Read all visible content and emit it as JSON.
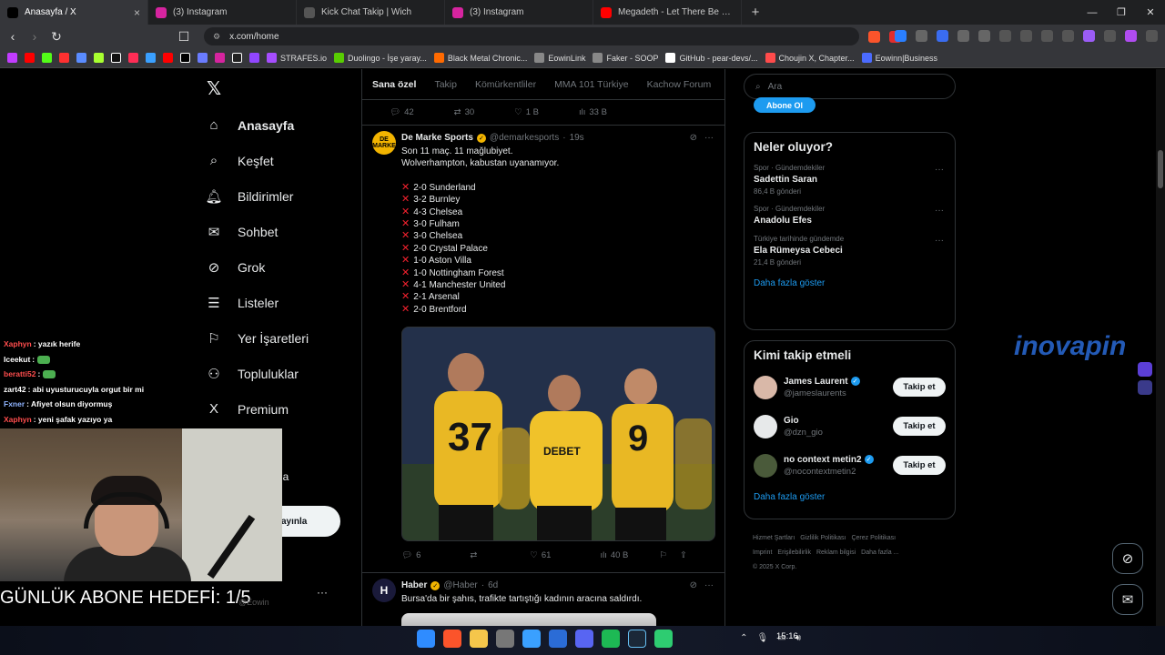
{
  "browser": {
    "tabs": [
      {
        "title": "Anasayfa / X",
        "favicon": "x-icon",
        "color": "#000000",
        "active": true
      },
      {
        "title": "(3) Instagram",
        "favicon": "instagram-icon",
        "color": "#d6249f",
        "active": false
      },
      {
        "title": "Kick Chat Takip | Wich",
        "favicon": "globe-icon",
        "color": "#555555",
        "active": false
      },
      {
        "title": "(3) Instagram",
        "favicon": "instagram-icon",
        "color": "#d6249f",
        "active": false
      },
      {
        "title": "Megadeth - Let There Be Shred (Offici",
        "favicon": "youtube-icon",
        "color": "#ff0000",
        "active": false
      }
    ],
    "url": "x.com/home",
    "bookmarks": [
      {
        "label": "STRAFES.io",
        "color": "#a64dff"
      },
      {
        "label": "Duolingo - İşe yaray...",
        "color": "#58cc02"
      },
      {
        "label": "Black Metal Chronic...",
        "color": "#ff6a00"
      },
      {
        "label": "EowinLink",
        "color": "#888888"
      },
      {
        "label": "Faker - SOOP",
        "color": "#888888"
      },
      {
        "label": "GitHub - pear-devs/...",
        "color": "#ffffff"
      },
      {
        "label": "Choujin X, Chapter...",
        "color": "#ff4b4b"
      },
      {
        "label": "Eowinn|Business",
        "color": "#4b6bff"
      }
    ]
  },
  "x_nav": {
    "items": [
      {
        "label": "Anasayfa",
        "icon": "home-icon",
        "glyph": "⌂",
        "active": true
      },
      {
        "label": "Keşfet",
        "icon": "search-icon",
        "glyph": "⌕",
        "active": false
      },
      {
        "label": "Bildirimler",
        "icon": "bell-icon",
        "glyph": "🔔︎",
        "active": false
      },
      {
        "label": "Sohbet",
        "icon": "mail-icon",
        "glyph": "✉",
        "active": false
      },
      {
        "label": "Grok",
        "icon": "grok-icon",
        "glyph": "⊘",
        "active": false
      },
      {
        "label": "Listeler",
        "icon": "list-icon",
        "glyph": "☰",
        "active": false
      },
      {
        "label": "Yer İşaretleri",
        "icon": "bookmark-icon",
        "glyph": "⚐",
        "active": false
      },
      {
        "label": "Topluluklar",
        "icon": "communities-icon",
        "glyph": "⚇",
        "active": false
      },
      {
        "label": "Premium",
        "icon": "x-icon",
        "glyph": "X",
        "active": false
      }
    ],
    "more_label": "zla",
    "post_button": "ayınla"
  },
  "feed": {
    "tabs": [
      "Sana özel",
      "Takip",
      "Kömürkentliler",
      "MMA 101 Türkiye",
      "Kachow Forum"
    ],
    "prev_stats": {
      "replies": "42",
      "reposts": "30",
      "likes": "1 B",
      "views": "33 B"
    },
    "tweet1": {
      "name": "De Marke Sports",
      "handle": "@demarkesports",
      "time": "19s",
      "avatar_text": "DE MARKE",
      "line1": "Son 11 maç. 11 mağlubiyet.",
      "line2": "Wolverhampton, kabustan uyanamıyor.",
      "results": [
        "2-0 Sunderland",
        "3-2 Burnley",
        "4-3 Chelsea",
        "3-0 Fulham",
        "3-0 Chelsea",
        "2-0 Crystal Palace",
        "1-0 Aston Villa",
        "1-0 Nottingham Forest",
        "4-1 Manchester United",
        "2-1 Arsenal",
        "2-0 Brentford"
      ],
      "replies": "6",
      "reposts": "",
      "likes": "61",
      "views": "40 B"
    },
    "tweet2": {
      "name": "Haber",
      "handle": "@Haber",
      "time": "6d",
      "avatar_text": "H",
      "text": "Bursa'da bir şahıs, trafikte tartıştığı kadının aracına saldırdı."
    }
  },
  "right": {
    "search_placeholder": "Ara",
    "subscribe_label": "Abone Ol",
    "trends_title": "Neler oluyor?",
    "trends": [
      {
        "meta": "Spor · Gündemdekiler",
        "name": "Sadettin Saran",
        "count": "86,4 B gönderi"
      },
      {
        "meta": "Spor · Gündemdekiler",
        "name": "Anadolu Efes",
        "count": ""
      },
      {
        "meta": "Türkiye tarihinde gündemde",
        "name": "Ela Rümeysa Cebeci",
        "count": "21,4 B gönderi"
      }
    ],
    "show_more": "Daha fazla göster",
    "who_title": "Kimi takip etmeli",
    "who": [
      {
        "name": "James Laurent",
        "handle": "@jameslaurents",
        "verified": true,
        "color": "#d9b8a8"
      },
      {
        "name": "Gio",
        "handle": "@dzn_gio",
        "verified": false,
        "color": "#e7e9ea"
      },
      {
        "name": "no context metin2",
        "handle": "@nocontextmetin2",
        "verified": true,
        "color": "#4a5a3a"
      }
    ],
    "follow_label": "Takip et",
    "footer": [
      "Hizmet Şartları",
      "Gizlilik Politikası",
      "Çerez Politikası",
      "Imprint",
      "Erişilebilirlik",
      "Reklam bilgisi",
      "Daha fazla ...",
      "© 2025 X Corp."
    ]
  },
  "stream": {
    "chat": [
      {
        "user": "Xaphyn",
        "color": "#ff4d4d",
        "msg": "yazık herife"
      },
      {
        "user": "Iceekut",
        "color": "#ffffff",
        "msg": ""
      },
      {
        "user": "beratti52",
        "color": "#ff4d4d",
        "msg": ""
      },
      {
        "user": "zart42",
        "color": "#ffffff",
        "msg": "abi uyusturucuyla orgut bir mi"
      },
      {
        "user": "Fxner",
        "color": "#8fb4ff",
        "msg": "Afiyet olsun diyormuş"
      },
      {
        "user": "Xaphyn",
        "color": "#ff4d4d",
        "msg": "yeni şafak yazıyo ya"
      }
    ],
    "goal_text": "GÜNLÜK ABONE HEDEFİ: 1/5",
    "overlay_handle": "@Eowin",
    "logo_text": "inovapin"
  },
  "taskbar": {
    "time": "15:16"
  }
}
